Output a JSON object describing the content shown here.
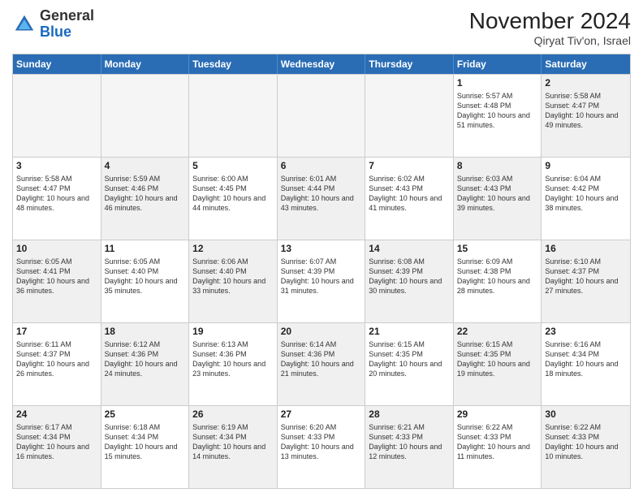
{
  "logo": {
    "general": "General",
    "blue": "Blue"
  },
  "header": {
    "month_title": "November 2024",
    "location": "Qiryat Tiv'on, Israel"
  },
  "weekdays": [
    "Sunday",
    "Monday",
    "Tuesday",
    "Wednesday",
    "Thursday",
    "Friday",
    "Saturday"
  ],
  "rows": [
    [
      {
        "day": "",
        "info": "",
        "empty": true
      },
      {
        "day": "",
        "info": "",
        "empty": true
      },
      {
        "day": "",
        "info": "",
        "empty": true
      },
      {
        "day": "",
        "info": "",
        "empty": true
      },
      {
        "day": "",
        "info": "",
        "empty": true
      },
      {
        "day": "1",
        "info": "Sunrise: 5:57 AM\nSunset: 4:48 PM\nDaylight: 10 hours and 51 minutes."
      },
      {
        "day": "2",
        "info": "Sunrise: 5:58 AM\nSunset: 4:47 PM\nDaylight: 10 hours and 49 minutes.",
        "shaded": true
      }
    ],
    [
      {
        "day": "3",
        "info": "Sunrise: 5:58 AM\nSunset: 4:47 PM\nDaylight: 10 hours and 48 minutes."
      },
      {
        "day": "4",
        "info": "Sunrise: 5:59 AM\nSunset: 4:46 PM\nDaylight: 10 hours and 46 minutes.",
        "shaded": true
      },
      {
        "day": "5",
        "info": "Sunrise: 6:00 AM\nSunset: 4:45 PM\nDaylight: 10 hours and 44 minutes."
      },
      {
        "day": "6",
        "info": "Sunrise: 6:01 AM\nSunset: 4:44 PM\nDaylight: 10 hours and 43 minutes.",
        "shaded": true
      },
      {
        "day": "7",
        "info": "Sunrise: 6:02 AM\nSunset: 4:43 PM\nDaylight: 10 hours and 41 minutes."
      },
      {
        "day": "8",
        "info": "Sunrise: 6:03 AM\nSunset: 4:43 PM\nDaylight: 10 hours and 39 minutes.",
        "shaded": true
      },
      {
        "day": "9",
        "info": "Sunrise: 6:04 AM\nSunset: 4:42 PM\nDaylight: 10 hours and 38 minutes."
      }
    ],
    [
      {
        "day": "10",
        "info": "Sunrise: 6:05 AM\nSunset: 4:41 PM\nDaylight: 10 hours and 36 minutes.",
        "shaded": true
      },
      {
        "day": "11",
        "info": "Sunrise: 6:05 AM\nSunset: 4:40 PM\nDaylight: 10 hours and 35 minutes."
      },
      {
        "day": "12",
        "info": "Sunrise: 6:06 AM\nSunset: 4:40 PM\nDaylight: 10 hours and 33 minutes.",
        "shaded": true
      },
      {
        "day": "13",
        "info": "Sunrise: 6:07 AM\nSunset: 4:39 PM\nDaylight: 10 hours and 31 minutes."
      },
      {
        "day": "14",
        "info": "Sunrise: 6:08 AM\nSunset: 4:39 PM\nDaylight: 10 hours and 30 minutes.",
        "shaded": true
      },
      {
        "day": "15",
        "info": "Sunrise: 6:09 AM\nSunset: 4:38 PM\nDaylight: 10 hours and 28 minutes."
      },
      {
        "day": "16",
        "info": "Sunrise: 6:10 AM\nSunset: 4:37 PM\nDaylight: 10 hours and 27 minutes.",
        "shaded": true
      }
    ],
    [
      {
        "day": "17",
        "info": "Sunrise: 6:11 AM\nSunset: 4:37 PM\nDaylight: 10 hours and 26 minutes."
      },
      {
        "day": "18",
        "info": "Sunrise: 6:12 AM\nSunset: 4:36 PM\nDaylight: 10 hours and 24 minutes.",
        "shaded": true
      },
      {
        "day": "19",
        "info": "Sunrise: 6:13 AM\nSunset: 4:36 PM\nDaylight: 10 hours and 23 minutes."
      },
      {
        "day": "20",
        "info": "Sunrise: 6:14 AM\nSunset: 4:36 PM\nDaylight: 10 hours and 21 minutes.",
        "shaded": true
      },
      {
        "day": "21",
        "info": "Sunrise: 6:15 AM\nSunset: 4:35 PM\nDaylight: 10 hours and 20 minutes."
      },
      {
        "day": "22",
        "info": "Sunrise: 6:15 AM\nSunset: 4:35 PM\nDaylight: 10 hours and 19 minutes.",
        "shaded": true
      },
      {
        "day": "23",
        "info": "Sunrise: 6:16 AM\nSunset: 4:34 PM\nDaylight: 10 hours and 18 minutes."
      }
    ],
    [
      {
        "day": "24",
        "info": "Sunrise: 6:17 AM\nSunset: 4:34 PM\nDaylight: 10 hours and 16 minutes.",
        "shaded": true
      },
      {
        "day": "25",
        "info": "Sunrise: 6:18 AM\nSunset: 4:34 PM\nDaylight: 10 hours and 15 minutes."
      },
      {
        "day": "26",
        "info": "Sunrise: 6:19 AM\nSunset: 4:34 PM\nDaylight: 10 hours and 14 minutes.",
        "shaded": true
      },
      {
        "day": "27",
        "info": "Sunrise: 6:20 AM\nSunset: 4:33 PM\nDaylight: 10 hours and 13 minutes."
      },
      {
        "day": "28",
        "info": "Sunrise: 6:21 AM\nSunset: 4:33 PM\nDaylight: 10 hours and 12 minutes.",
        "shaded": true
      },
      {
        "day": "29",
        "info": "Sunrise: 6:22 AM\nSunset: 4:33 PM\nDaylight: 10 hours and 11 minutes."
      },
      {
        "day": "30",
        "info": "Sunrise: 6:22 AM\nSunset: 4:33 PM\nDaylight: 10 hours and 10 minutes.",
        "shaded": true
      }
    ]
  ]
}
